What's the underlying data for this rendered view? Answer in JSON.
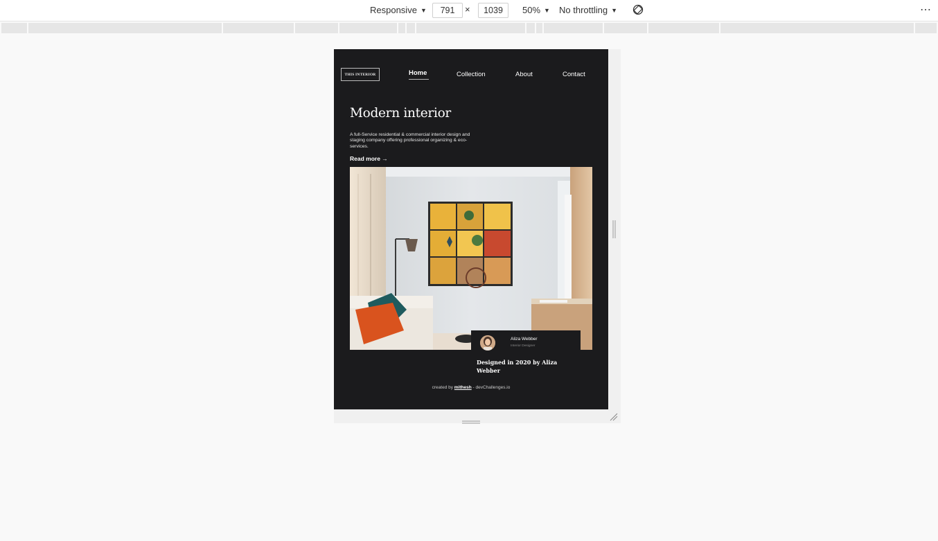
{
  "toolbar": {
    "device_mode": "Responsive",
    "width": "791",
    "height": "1039",
    "dimension_separator": "×",
    "zoom": "50%",
    "throttling": "No throttling",
    "rotate_icon": "rotate-icon",
    "more_icon": "more-options-icon",
    "more_glyph": "⋯",
    "caret": "▼"
  },
  "site": {
    "logo": "THIS INTERIOR",
    "nav": {
      "home": "Home",
      "collection": "Collection",
      "about": "About",
      "contact": "Contact"
    },
    "hero": {
      "title": "Modern interior",
      "description": "A full-Service residential & commercial interior design and staging company offering professional organizing & eco-services.",
      "read_more": "Read more →"
    },
    "designer_card": {
      "name": "Aliza Webber",
      "role": "Interior Designer",
      "caption": "Designed in 2020 by Aliza Webber"
    },
    "footer": {
      "prefix": "created by ",
      "author": "mithesh",
      "suffix": " - devChallenges.io"
    }
  },
  "colors": {
    "page_bg": "#1b1b1d",
    "devtools_bg": "#f9f9f9",
    "wall": "#dfe3e6",
    "mustard": "#e9b23a",
    "pillow_orange": "#d9531e",
    "pillow_teal": "#1f5b5e"
  }
}
